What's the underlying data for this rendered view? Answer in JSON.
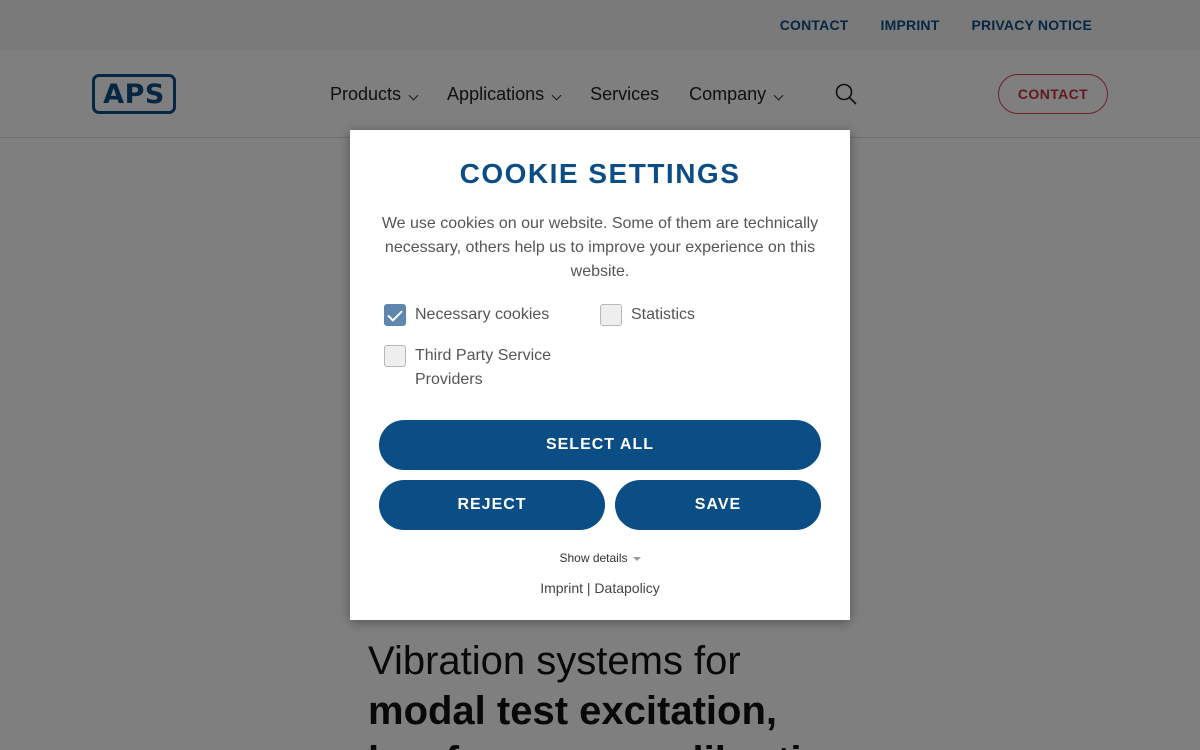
{
  "topbar": {
    "links": [
      "CONTACT",
      "IMPRINT",
      "PRIVACY NOTICE"
    ]
  },
  "header": {
    "logo_text": "APS",
    "nav": [
      {
        "label": "Products",
        "has_dropdown": true
      },
      {
        "label": "Applications",
        "has_dropdown": true
      },
      {
        "label": "Services",
        "has_dropdown": false
      },
      {
        "label": "Company",
        "has_dropdown": true
      }
    ],
    "contact_label": "CONTACT"
  },
  "hero": {
    "line1": "Vibration systems for",
    "line2": "modal test excitation,",
    "line3": "low frequency calibration"
  },
  "cookie": {
    "title": "COOKIE SETTINGS",
    "text": "We use cookies on our website. Some of them are technically necessary, others help us to improve your experience on this website.",
    "options": [
      {
        "label": "Necessary cookies",
        "checked": true
      },
      {
        "label": "Statistics",
        "checked": false
      },
      {
        "label": "Third Party Service Providers",
        "checked": false
      }
    ],
    "select_all": "SELECT ALL",
    "reject": "REJECT",
    "save": "SAVE",
    "show_details": "Show details",
    "imprint": "Imprint",
    "separator": "|",
    "datapolicy": "Datapolicy"
  },
  "colors": {
    "brand_blue": "#0b4e86",
    "contact_red": "#c9303e",
    "checkbox_checked": "#5f86ad"
  }
}
